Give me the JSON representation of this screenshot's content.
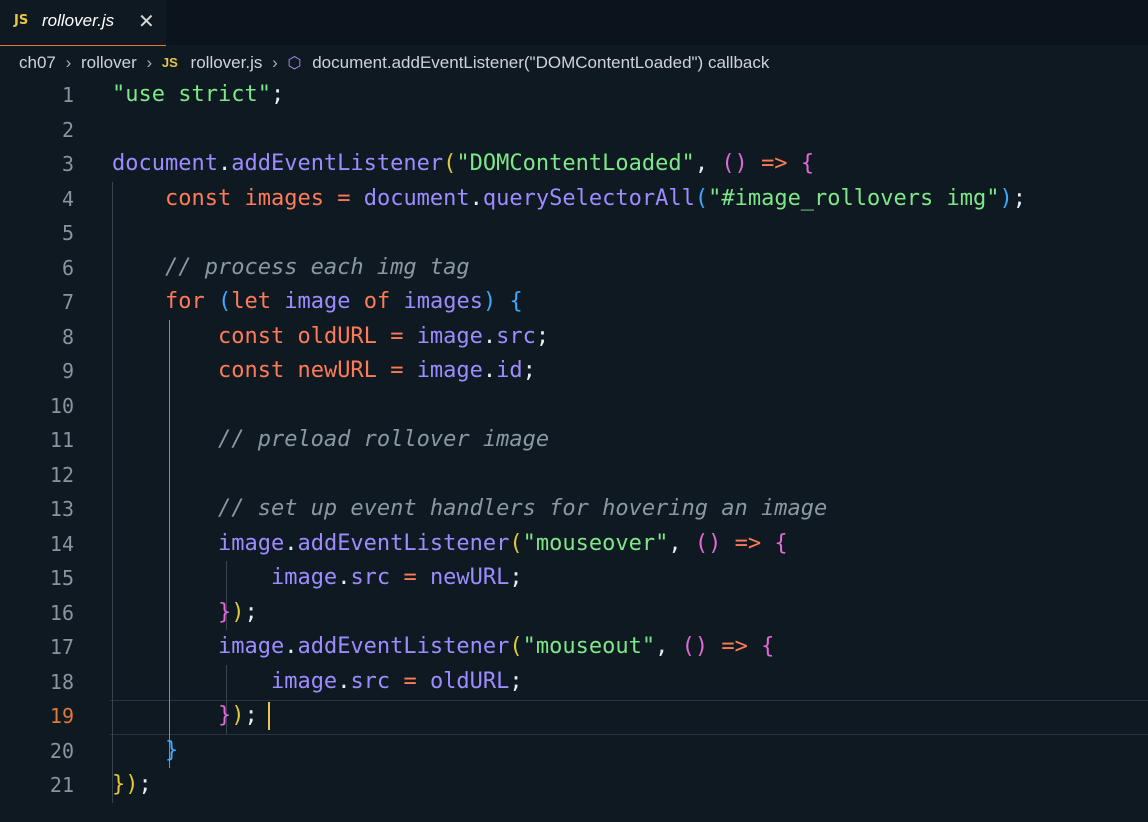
{
  "tab": {
    "badge": "JS",
    "name": "rollover.js",
    "close": "✕"
  },
  "breadcrumb": {
    "items": [
      "ch07",
      "rollover",
      "rollover.js",
      "document.addEventListener(\"DOMContentLoaded\") callback"
    ],
    "file_badge": "JS"
  },
  "editor": {
    "active_line": 19,
    "lines": [
      {
        "n": "1",
        "t": [
          [
            "str",
            "\"use strict\""
          ],
          [
            "pl",
            ";"
          ]
        ]
      },
      {
        "n": "2",
        "t": []
      },
      {
        "n": "3",
        "t": [
          [
            "var",
            "document"
          ],
          [
            "pl",
            "."
          ],
          [
            "fn",
            "addEventListener"
          ],
          [
            "p1",
            "("
          ],
          [
            "str",
            "\"DOMContentLoaded\""
          ],
          [
            "pl",
            ", "
          ],
          [
            "p2",
            "()"
          ],
          [
            "pl",
            " "
          ],
          [
            "op",
            "=>"
          ],
          [
            "pl",
            " "
          ],
          [
            "p2",
            "{"
          ]
        ]
      },
      {
        "n": "4",
        "t": [
          [
            "pl",
            "    "
          ],
          [
            "kw",
            "const"
          ],
          [
            "pl",
            " "
          ],
          [
            "kw",
            "images"
          ],
          [
            "pl",
            " "
          ],
          [
            "op",
            "="
          ],
          [
            "pl",
            " "
          ],
          [
            "var",
            "document"
          ],
          [
            "pl",
            "."
          ],
          [
            "fn",
            "querySelectorAll"
          ],
          [
            "p3",
            "("
          ],
          [
            "str",
            "\"#image_rollovers img\""
          ],
          [
            "p3",
            ")"
          ],
          [
            "pl",
            ";"
          ]
        ]
      },
      {
        "n": "5",
        "t": []
      },
      {
        "n": "6",
        "t": [
          [
            "pl",
            "    "
          ],
          [
            "com",
            "// process each img tag"
          ]
        ]
      },
      {
        "n": "7",
        "t": [
          [
            "pl",
            "    "
          ],
          [
            "kw",
            "for"
          ],
          [
            "pl",
            " "
          ],
          [
            "p3",
            "("
          ],
          [
            "kw",
            "let"
          ],
          [
            "pl",
            " "
          ],
          [
            "var",
            "image"
          ],
          [
            "pl",
            " "
          ],
          [
            "kw",
            "of"
          ],
          [
            "pl",
            " "
          ],
          [
            "var",
            "images"
          ],
          [
            "p3",
            ")"
          ],
          [
            "pl",
            " "
          ],
          [
            "p3",
            "{"
          ]
        ]
      },
      {
        "n": "8",
        "t": [
          [
            "pl",
            "        "
          ],
          [
            "kw",
            "const"
          ],
          [
            "pl",
            " "
          ],
          [
            "kw",
            "oldURL"
          ],
          [
            "pl",
            " "
          ],
          [
            "op",
            "="
          ],
          [
            "pl",
            " "
          ],
          [
            "var",
            "image"
          ],
          [
            "pl",
            "."
          ],
          [
            "prop",
            "src"
          ],
          [
            "pl",
            ";"
          ]
        ]
      },
      {
        "n": "9",
        "t": [
          [
            "pl",
            "        "
          ],
          [
            "kw",
            "const"
          ],
          [
            "pl",
            " "
          ],
          [
            "kw",
            "newURL"
          ],
          [
            "pl",
            " "
          ],
          [
            "op",
            "="
          ],
          [
            "pl",
            " "
          ],
          [
            "var",
            "image"
          ],
          [
            "pl",
            "."
          ],
          [
            "prop",
            "id"
          ],
          [
            "pl",
            ";"
          ]
        ]
      },
      {
        "n": "10",
        "t": []
      },
      {
        "n": "11",
        "t": [
          [
            "pl",
            "        "
          ],
          [
            "com",
            "// preload rollover image"
          ]
        ]
      },
      {
        "n": "12",
        "t": []
      },
      {
        "n": "13",
        "t": [
          [
            "pl",
            "        "
          ],
          [
            "com",
            "// set up event handlers for hovering an image"
          ]
        ]
      },
      {
        "n": "14",
        "t": [
          [
            "pl",
            "        "
          ],
          [
            "var",
            "image"
          ],
          [
            "pl",
            "."
          ],
          [
            "fn",
            "addEventListener"
          ],
          [
            "p1",
            "("
          ],
          [
            "str",
            "\"mouseover\""
          ],
          [
            "pl",
            ", "
          ],
          [
            "p2",
            "()"
          ],
          [
            "pl",
            " "
          ],
          [
            "op",
            "=>"
          ],
          [
            "pl",
            " "
          ],
          [
            "p2",
            "{"
          ]
        ]
      },
      {
        "n": "15",
        "t": [
          [
            "pl",
            "            "
          ],
          [
            "var",
            "image"
          ],
          [
            "pl",
            "."
          ],
          [
            "prop",
            "src"
          ],
          [
            "pl",
            " "
          ],
          [
            "op",
            "="
          ],
          [
            "pl",
            " "
          ],
          [
            "var",
            "newURL"
          ],
          [
            "pl",
            ";"
          ]
        ]
      },
      {
        "n": "16",
        "t": [
          [
            "pl",
            "        "
          ],
          [
            "p2",
            "}"
          ],
          [
            "p1",
            ")"
          ],
          [
            "pl",
            ";"
          ]
        ]
      },
      {
        "n": "17",
        "t": [
          [
            "pl",
            "        "
          ],
          [
            "var",
            "image"
          ],
          [
            "pl",
            "."
          ],
          [
            "fn",
            "addEventListener"
          ],
          [
            "p1",
            "("
          ],
          [
            "str",
            "\"mouseout\""
          ],
          [
            "pl",
            ", "
          ],
          [
            "p2",
            "()"
          ],
          [
            "pl",
            " "
          ],
          [
            "op",
            "=>"
          ],
          [
            "pl",
            " "
          ],
          [
            "p2",
            "{"
          ]
        ]
      },
      {
        "n": "18",
        "t": [
          [
            "pl",
            "            "
          ],
          [
            "var",
            "image"
          ],
          [
            "pl",
            "."
          ],
          [
            "prop",
            "src"
          ],
          [
            "pl",
            " "
          ],
          [
            "op",
            "="
          ],
          [
            "pl",
            " "
          ],
          [
            "var",
            "oldURL"
          ],
          [
            "pl",
            ";"
          ]
        ]
      },
      {
        "n": "19",
        "t": [
          [
            "pl",
            "        "
          ],
          [
            "p2",
            "}"
          ],
          [
            "p1",
            ")"
          ],
          [
            "pl",
            ";"
          ]
        ]
      },
      {
        "n": "20",
        "t": [
          [
            "pl",
            "    "
          ],
          [
            "p3",
            "}"
          ]
        ]
      },
      {
        "n": "21",
        "t": [
          [
            "p1",
            "}"
          ],
          [
            "p1",
            ")"
          ],
          [
            "pl",
            ";"
          ]
        ]
      }
    ]
  }
}
